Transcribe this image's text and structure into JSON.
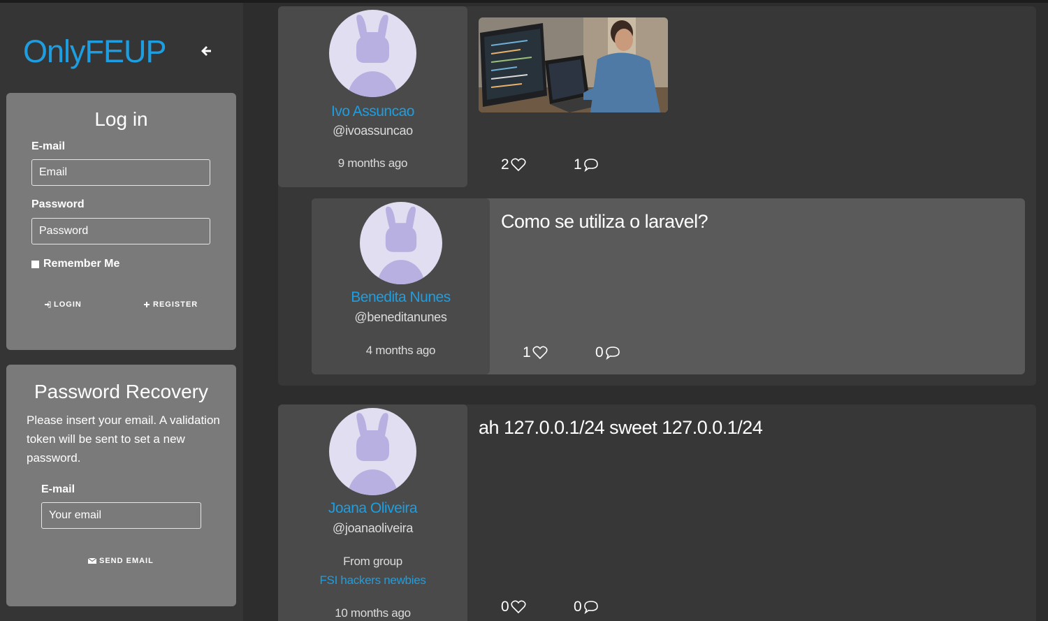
{
  "app": {
    "brand": "OnlyFEUP"
  },
  "login": {
    "title": "Log in",
    "email_label": "E-mail",
    "email_placeholder": "Email",
    "password_label": "Password",
    "password_placeholder": "Password",
    "remember_label": "Remember Me",
    "login_button": "LOGIN",
    "register_button": "REGISTER"
  },
  "recovery": {
    "title": "Password Recovery",
    "description": "Please insert your email. A validation token will be sent to set a new password.",
    "email_label": "E-mail",
    "email_placeholder": "Your email",
    "send_button": "SEND EMAIL"
  },
  "posts": [
    {
      "author": "Ivo Assuncao",
      "handle": "@ivoassuncao",
      "time": "9 months ago",
      "likes": "2",
      "comments": "1",
      "has_image": true,
      "comment": {
        "author": "Benedita Nunes",
        "handle": "@beneditanunes",
        "time": "4 months ago",
        "text": "Como se utiliza o laravel?",
        "likes": "1",
        "comments": "0"
      }
    },
    {
      "author": "Joana Oliveira",
      "handle": "@joanaoliveira",
      "group_prefix": "From group",
      "group_name": "FSI hackers newbies",
      "time": "10 months ago",
      "text": "ah 127.0.0.1/24 sweet 127.0.0.1/24",
      "likes": "0",
      "comments": "0"
    }
  ],
  "colors": {
    "accent": "#1e9ee0",
    "background": "#2d2d2d",
    "sidebar": "#353535",
    "panel": "#7a7a7a",
    "card": "#373737",
    "author_box": "#4a4a4a",
    "avatar": "#e2def2",
    "avatar_figure": "#b8b0e0"
  }
}
